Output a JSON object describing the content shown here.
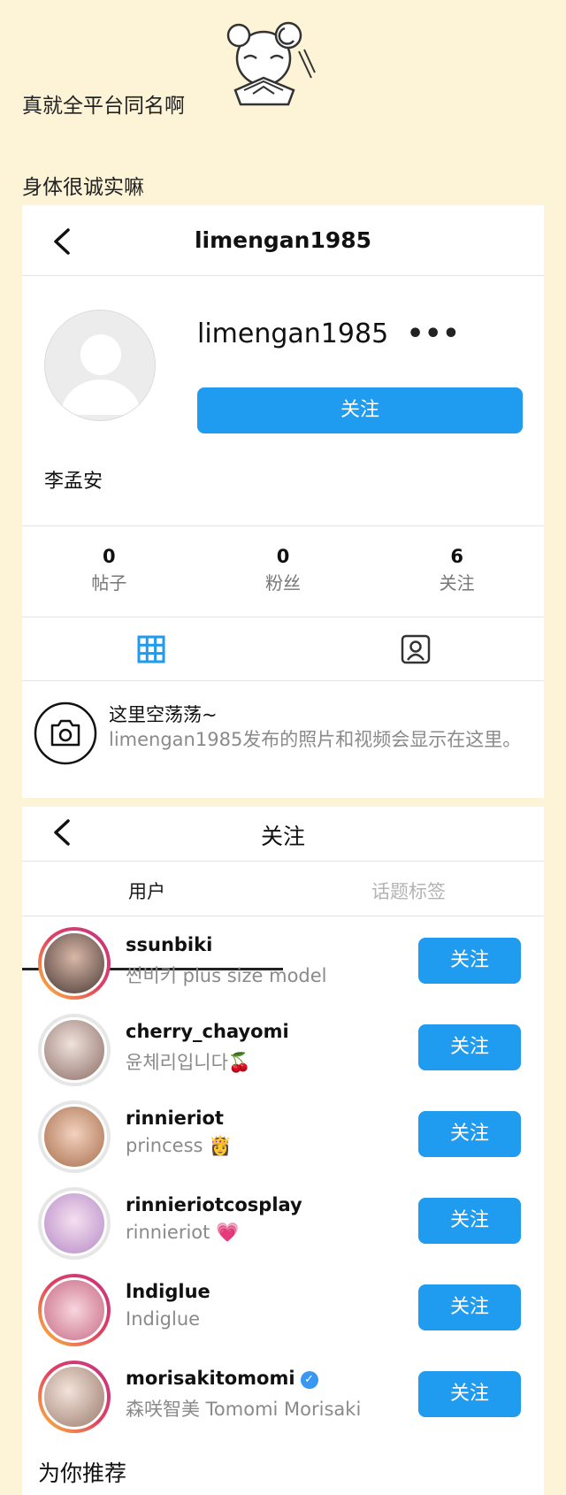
{
  "post": {
    "line1": "真就全平台同名啊",
    "line2": "身体很诚实嘛"
  },
  "profile": {
    "header_title": "limengan1985",
    "username": "limengan1985",
    "more_label": "•••",
    "follow_label": "关注",
    "full_name": "李孟安",
    "stats": [
      {
        "num": "0",
        "label": "帖子"
      },
      {
        "num": "0",
        "label": "粉丝"
      },
      {
        "num": "6",
        "label": "关注"
      }
    ],
    "empty_title": "这里空荡荡~",
    "empty_desc": "limengan1985发布的照片和视频会显示在这里。"
  },
  "following": {
    "header_title": "关注",
    "tabs": [
      "用户",
      "话题标签"
    ],
    "users": [
      {
        "name": "ssunbiki",
        "sub": "썬비키 plus size model",
        "btn": "关注"
      },
      {
        "name": "cherry_chayomi",
        "sub": "윤체리입니다🍒",
        "btn": "关注"
      },
      {
        "name": "rinnieriot",
        "sub": "princess 👸",
        "btn": "关注"
      },
      {
        "name": "rinnieriotcosplay",
        "sub": "rinnieriot 💗",
        "btn": "关注"
      },
      {
        "name": "lndiglue",
        "sub": "Indiglue",
        "btn": "关注"
      },
      {
        "name": "morisakitomomi",
        "sub": "森咲智美 Tomomi Morisaki",
        "btn": "关注",
        "verified": true
      }
    ],
    "suggest_title": "为你推荐"
  },
  "colors": {
    "background": "#fdf3d6",
    "accent_blue": "#1f9bf0",
    "story_ring": "#d6249f"
  }
}
